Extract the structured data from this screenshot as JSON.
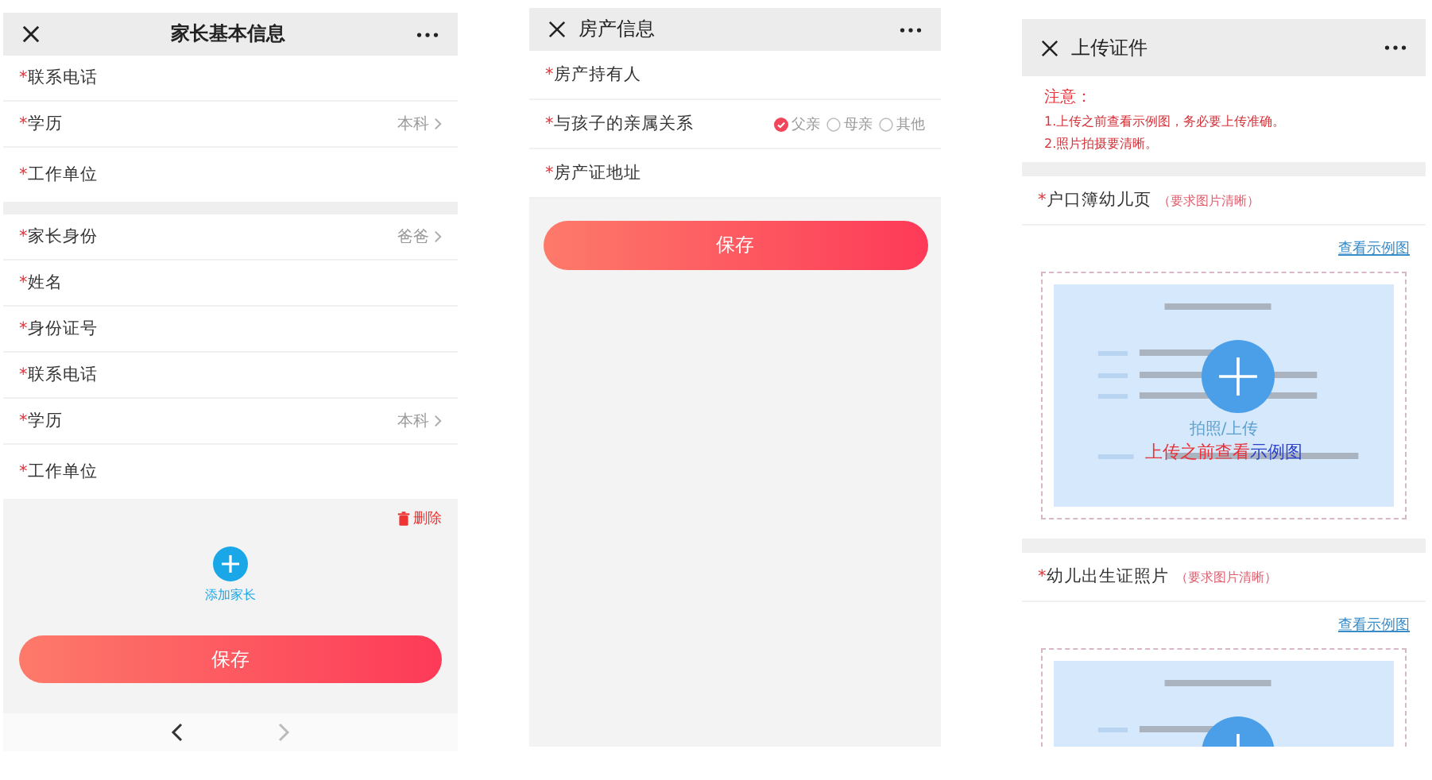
{
  "parent_info": {
    "title": "家长基本信息",
    "sections": [
      {
        "rows": [
          {
            "kind": "input",
            "mark": "*",
            "label": "联系电话"
          },
          {
            "kind": "select",
            "mark": "*",
            "label": "学历",
            "value": "本科"
          },
          {
            "kind": "multiline",
            "mark": "*",
            "label": "工作单位"
          }
        ]
      },
      {
        "rows": [
          {
            "kind": "select",
            "mark": "*",
            "label": "家长身份",
            "value": "爸爸"
          },
          {
            "kind": "input",
            "mark": "*",
            "label": "姓名"
          },
          {
            "kind": "input",
            "mark": "*",
            "label": "身份证号"
          },
          {
            "kind": "input",
            "mark": "*",
            "label": "联系电话"
          },
          {
            "kind": "select",
            "mark": "*",
            "label": "学历",
            "value": "本科"
          },
          {
            "kind": "multiline",
            "mark": "*",
            "label": "工作单位"
          }
        ]
      }
    ],
    "delete_label": "删除",
    "add_label": "添加家长",
    "save": "保存",
    "nav": {
      "back_disabled": false,
      "forward_disabled": true
    }
  },
  "property_info": {
    "title": "房产信息",
    "rows": [
      {
        "kind": "input",
        "mark": "*",
        "label": "房产持有人"
      },
      {
        "kind": "radio",
        "mark": "*",
        "label": "与孩子的亲属关系",
        "options": [
          {
            "label": "父亲",
            "selected": true
          },
          {
            "label": "母亲",
            "selected": false
          },
          {
            "label": "其他",
            "selected": false
          }
        ]
      },
      {
        "kind": "input",
        "mark": "*",
        "label": "房产证地址"
      }
    ],
    "save": "保存"
  },
  "upload_docs": {
    "title": "上传证件",
    "notice": {
      "title": "注意：",
      "lines": [
        "1.上传之前查看示例图，务必要上传准确。",
        "2.照片拍摄要清晰。"
      ]
    },
    "uploads": [
      {
        "mark": "*",
        "label": "户口簿幼儿页",
        "note": "（要求图片清晰）",
        "link": "查看示例图",
        "caption": "拍照/上传",
        "hint_parts": [
          {
            "text": "上传之前查看",
            "color": "#e8333a"
          },
          {
            "text": "示例图",
            "color": "#2f43c8"
          }
        ]
      },
      {
        "mark": "*",
        "label": "幼儿出生证照片",
        "note": "（要求图片清晰）",
        "link": "查看示例图"
      }
    ]
  }
}
